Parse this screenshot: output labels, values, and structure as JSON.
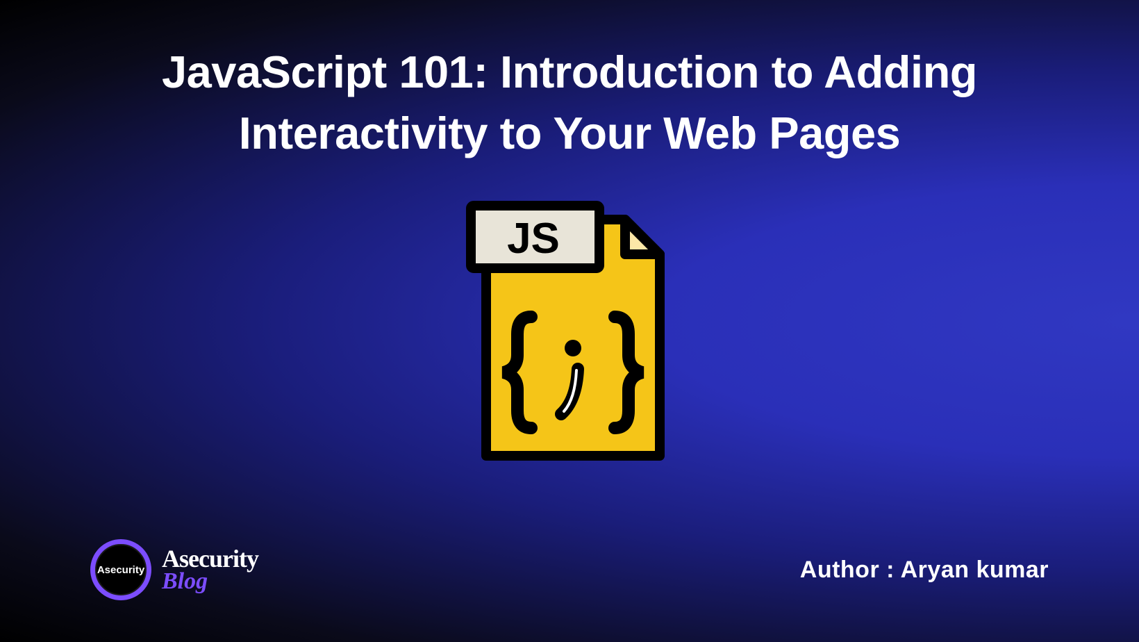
{
  "title": "JavaScript 101: Introduction to Adding Interactivity to Your Web Pages",
  "icon": {
    "label": "JS",
    "brace_content": "i"
  },
  "logo": {
    "inner_text": "Asecurity",
    "title": "Asecurity",
    "subtitle": "Blog"
  },
  "author_line": "Author : Aryan kumar"
}
